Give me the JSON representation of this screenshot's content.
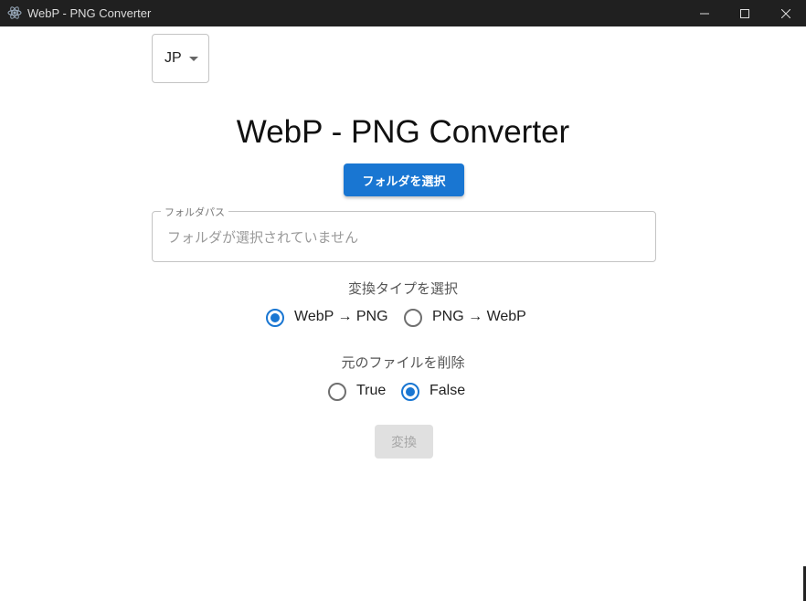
{
  "window": {
    "title": "WebP - PNG Converter",
    "icon": "electron-app-icon",
    "controls": [
      "minimize-icon",
      "maximize-icon",
      "close-icon"
    ]
  },
  "language": {
    "selected": "JP",
    "icon": "caret-down-icon"
  },
  "main": {
    "title": "WebP - PNG Converter",
    "select_folder_label": "フォルダを選択",
    "folder_path": {
      "label": "フォルダパス",
      "value": "",
      "placeholder": "フォルダが選択されていません"
    },
    "conversion": {
      "label": "変換タイプを選択",
      "options": [
        {
          "label": "WebP → PNG",
          "checked": true
        },
        {
          "label": "PNG → WebP",
          "checked": false
        }
      ]
    },
    "delete_original": {
      "label": "元のファイルを削除",
      "options": [
        {
          "label": "True",
          "checked": false
        },
        {
          "label": "False",
          "checked": true
        }
      ]
    },
    "convert_label": "変換",
    "convert_disabled": true
  },
  "colors": {
    "primary": "#1976d2",
    "titlebar": "#202020",
    "disabled_bg": "#e0e0e0",
    "disabled_text": "#a6a6a6"
  }
}
